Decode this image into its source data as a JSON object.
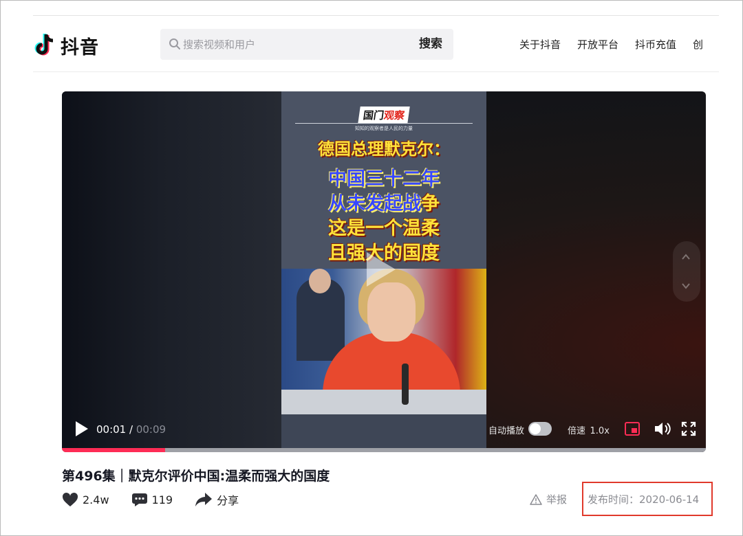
{
  "header": {
    "logo_text": "抖音",
    "search": {
      "placeholder": "搜索视频和用户",
      "value": "",
      "button_label": "搜索"
    },
    "nav": [
      "关于抖音",
      "开放平台",
      "抖币充值",
      "创"
    ]
  },
  "player": {
    "overlay": {
      "brand": [
        "国门",
        "观察"
      ],
      "brand_sub": "知知的观察者是人民的力量",
      "headline": "德国总理默克尔：",
      "lines": [
        {
          "parts": [
            {
              "text": "中国三十二年",
              "color": "blue"
            }
          ]
        },
        {
          "parts": [
            {
              "text": "从未发起战",
              "color": "blue"
            },
            {
              "text": "争",
              "color": "yellow"
            }
          ]
        },
        {
          "parts": [
            {
              "text": "这是一个温柔",
              "color": "yellow"
            }
          ]
        },
        {
          "parts": [
            {
              "text": "且强大的国度",
              "color": "yellow"
            }
          ]
        }
      ]
    },
    "current_time": "00:01",
    "separator": " / ",
    "duration": "00:09",
    "autoplay_label": "自动播放",
    "autoplay_on": false,
    "speed_label": "倍速",
    "speed_value": "1.0x",
    "progress_fraction": 0.16,
    "colors": {
      "progress": "#fe2c55",
      "pip": "#fe2c55"
    }
  },
  "video_info": {
    "title": "第496集｜默克尔评价中国:温柔而强大的国度",
    "likes": "2.4w",
    "comments": "119",
    "share_label": "分享",
    "report_label": "举报",
    "publish_label": "发布时间：",
    "publish_date": "2020-06-14"
  },
  "annotation": {
    "highlight_color": "#e0392b"
  }
}
